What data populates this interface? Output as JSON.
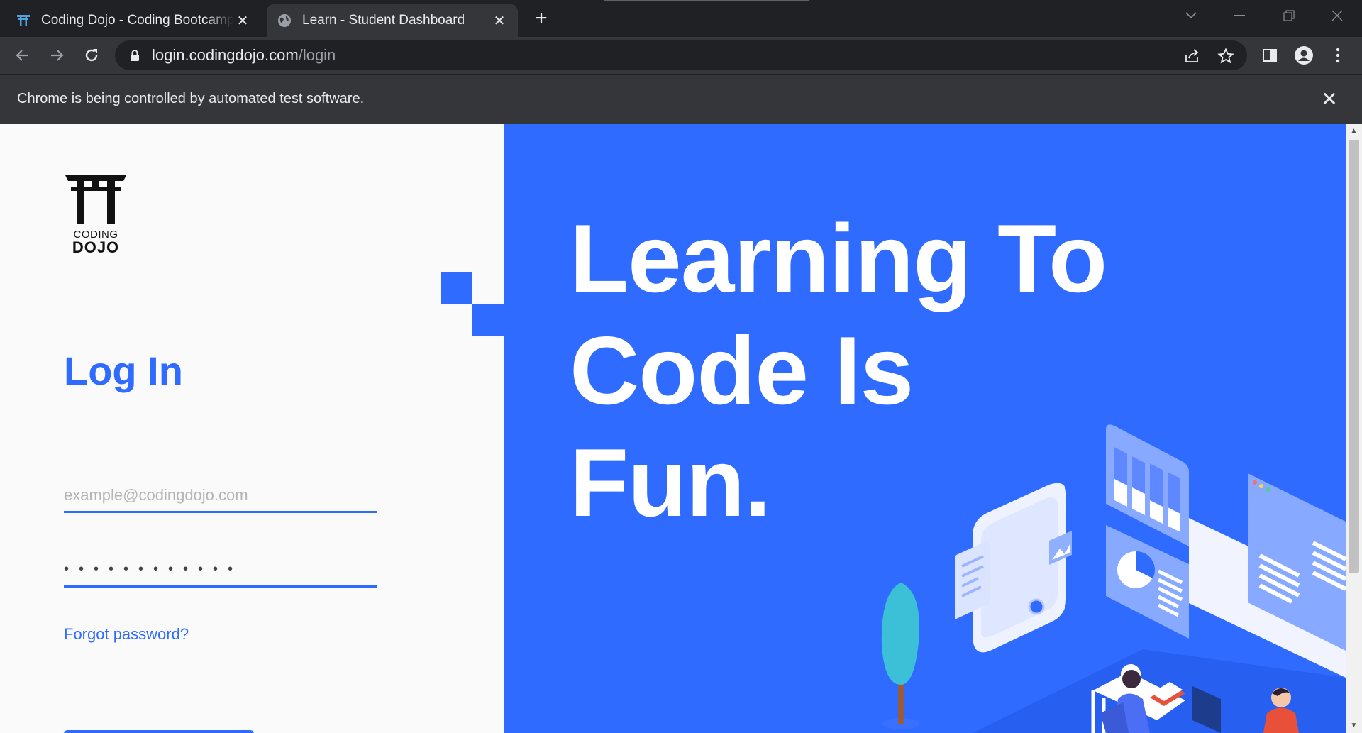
{
  "browser": {
    "tabs": [
      {
        "title": "Coding Dojo - Coding Bootcamps",
        "active": false,
        "favicon": "coding-dojo-torii-icon"
      },
      {
        "title": "Learn - Student Dashboard",
        "active": true,
        "favicon": "globe-icon"
      }
    ],
    "new_tab_glyph": "+",
    "close_glyph": "✕",
    "url_host": "login.codingdojo.com",
    "url_path": "/login",
    "infobar_message": "Chrome is being controlled by automated test software."
  },
  "page": {
    "logo_line1": "CODING",
    "logo_line2": "DOJO",
    "heading": "Log In",
    "email_placeholder": "example@codingdojo.com",
    "password_value": "••••••••••••",
    "forgot_link": "Forgot password?",
    "hero_lines": [
      "Learning To",
      "Code Is",
      "Fun."
    ]
  },
  "colors": {
    "brand_blue": "#2f6bff",
    "chrome_dark": "#202124",
    "chrome_toolbar": "#35363a",
    "page_bg": "#fafafa"
  }
}
